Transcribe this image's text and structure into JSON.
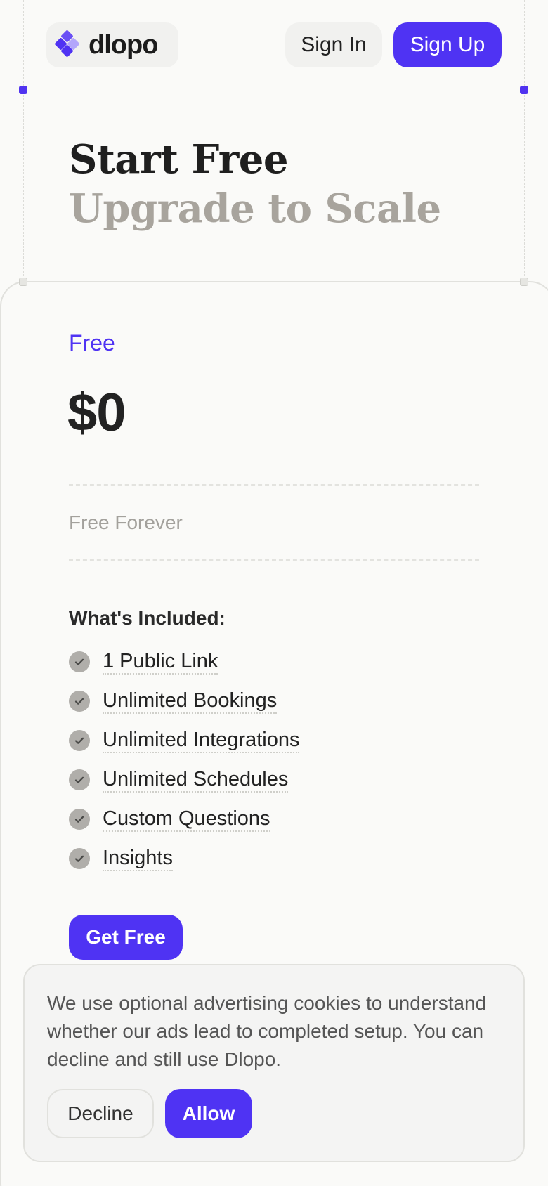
{
  "brand": {
    "name": "dlopo",
    "logo_icon": "diamond-logo-icon",
    "accent": "#4f33f3"
  },
  "header": {
    "signin_label": "Sign In",
    "signup_label": "Sign Up"
  },
  "hero": {
    "line1": "Start Free",
    "line2": "Upgrade to Scale"
  },
  "plan": {
    "name": "Free",
    "price": "$0",
    "note": "Free Forever",
    "included_title": "What's Included:",
    "features": [
      "1 Public Link",
      "Unlimited Bookings",
      "Unlimited Integrations",
      "Unlimited Schedules",
      "Custom Questions",
      "Insights"
    ],
    "cta_label": "Get Free"
  },
  "cookie": {
    "text": "We use optional advertising cookies to understand whether our ads lead to completed setup. You can decline and still use Dlopo.",
    "decline_label": "Decline",
    "allow_label": "Allow"
  }
}
